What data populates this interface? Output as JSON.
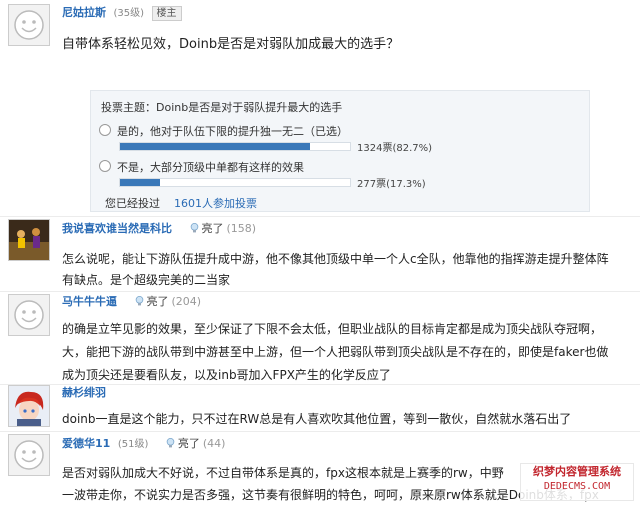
{
  "posts": [
    {
      "user": "尼姑拉斯",
      "level": "(35级)",
      "badge": "楼主",
      "question": "自带体系轻松见效，Doinb是否是对弱队加成最大的选手？"
    },
    {
      "user": "我说喜欢谁当然是科比",
      "like_label": "亮了",
      "like_count": "(158)",
      "lines": [
        "怎么说呢，能让下游队伍提升成中游，他不像其他顶级中单一个人c全队，他靠他的指挥游走提升整体阵",
        "有缺点。是个超级完美的二当家"
      ]
    },
    {
      "user": "马牛牛牛逼",
      "like_label": "亮了",
      "like_count": "(204)",
      "lines": [
        "的确是立竿见影的效果，至少保证了下限不会太低，但职业战队的目标肯定都是成为顶尖战队夺冠啊，",
        "大，能把下游的战队带到中游甚至中上游，但一个人把弱队带到顶尖战队是不存在的，即使是faker也做",
        "成为顶尖还是要看队友，以及inb哥加入FPX产生的化学反应了"
      ]
    },
    {
      "user": "赫杉绯羽",
      "lines": [
        "doinb一直是这个能力，只不过在RW总是有人喜欢吹其他位置，等到一散伙，自然就水落石出了"
      ]
    },
    {
      "user": "爱德华11",
      "level": "(51级)",
      "like_label": "亮了",
      "like_count": "(44)",
      "lines": [
        "是否对弱队加成大不好说，不过自带体系是真的，fpx这根本就是上赛季的rw，中野",
        "一波带走你，不说实力是否多强，这节奏有很鲜明的特色，呵呵，原来原rw体系就是Doinb体系，fpx"
      ]
    }
  ],
  "poll": {
    "title": "投票主题：Doinb是否是对于弱队提升最大的选手",
    "options": [
      {
        "label": "是的，他对于队伍下限的提升独一无二（已选）",
        "result": "1324票(82.7%)",
        "fraction": 0.827
      },
      {
        "label": "不是，大部分顶级中单都有这样的效果",
        "result": "277票(17.3%)",
        "fraction": 0.173
      }
    ],
    "voted_label": "您已经投过",
    "participants": "1601人参加投票"
  },
  "watermark": {
    "line1": "织梦内容管理系统",
    "line2": "DEDECMS.COM"
  },
  "colors": {
    "link": "#2a6bb5",
    "bar": "#3a78b9",
    "watermark": "#c2262e"
  },
  "icons": {
    "avatar": "default-smiley-avatar",
    "like": "lightbulb-icon"
  }
}
